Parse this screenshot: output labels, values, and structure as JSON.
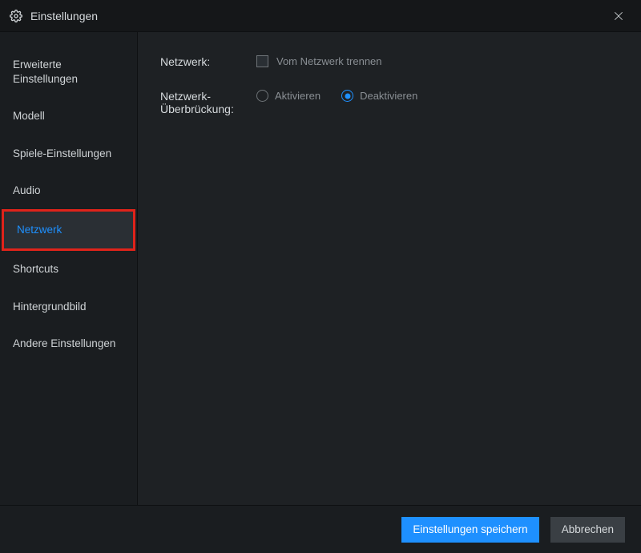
{
  "titlebar": {
    "title": "Einstellungen"
  },
  "sidebar": {
    "items": [
      {
        "label": "Erweiterte Einstellungen"
      },
      {
        "label": "Modell"
      },
      {
        "label": "Spiele-Einstellungen"
      },
      {
        "label": "Audio"
      },
      {
        "label": "Netzwerk"
      },
      {
        "label": "Shortcuts"
      },
      {
        "label": "Hintergrundbild"
      },
      {
        "label": "Andere Einstellungen"
      }
    ],
    "active_index": 4,
    "highlighted_index": 4
  },
  "main": {
    "network": {
      "label": "Netzwerk:",
      "checkbox_label": "Vom Netzwerk trennen",
      "checked": false
    },
    "bridging": {
      "label": "Netzwerk-Überbrückung:",
      "options": {
        "activate": "Aktivieren",
        "deactivate": "Deaktivieren"
      },
      "selected": "deactivate"
    }
  },
  "footer": {
    "save": "Einstellungen speichern",
    "cancel": "Abbrechen"
  }
}
